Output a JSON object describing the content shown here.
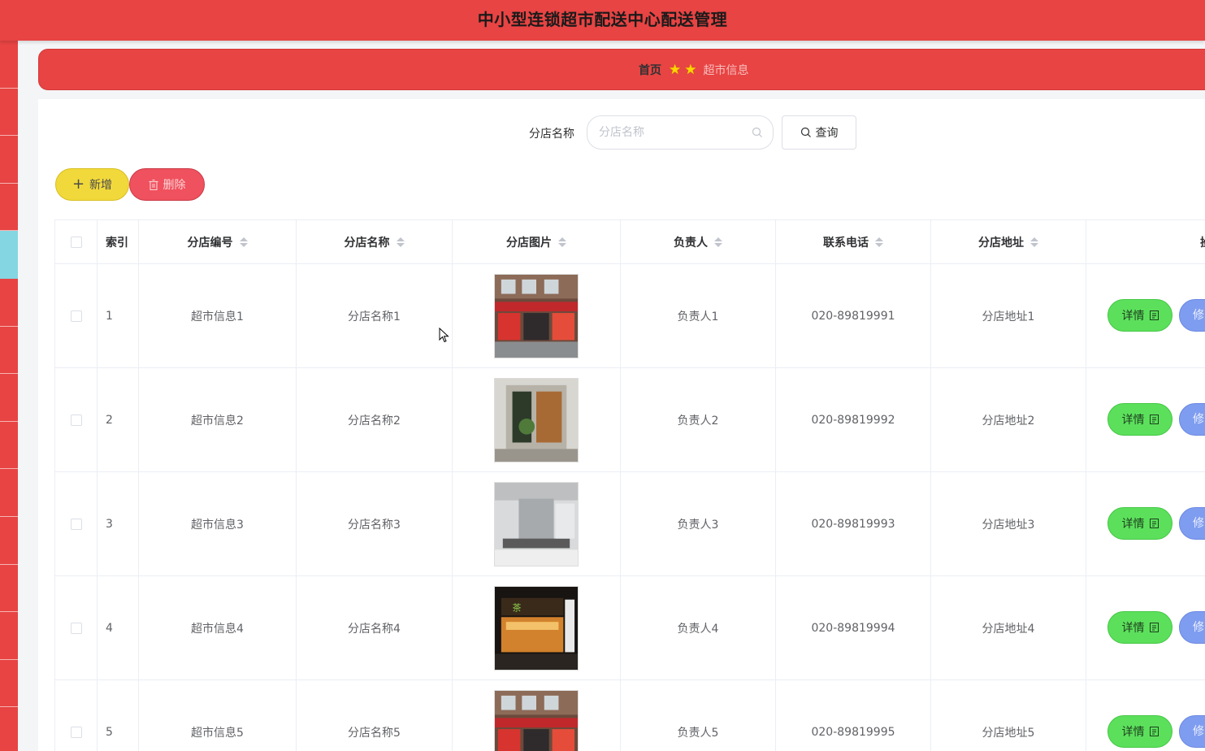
{
  "app": {
    "title": "中小型连锁超市配送中心配送管理"
  },
  "breadcrumb": {
    "home": "首页",
    "current": "超市信息"
  },
  "search": {
    "label": "分店名称",
    "placeholder": "分店名称",
    "value": "",
    "query_label": "查询"
  },
  "toolbar": {
    "add_label": "新增",
    "delete_label": "删除"
  },
  "table": {
    "columns": [
      "索引",
      "分店编号",
      "分店名称",
      "分店图片",
      "负责人",
      "联系电话",
      "分店地址",
      "操作"
    ],
    "detail_label": "详情",
    "edit_label": "修",
    "rows": [
      {
        "index": "1",
        "code": "超市信息1",
        "name": "分店名称1",
        "manager": "负责人1",
        "phone": "020-89819991",
        "address": "分店地址1",
        "image": "storefront-photo-1"
      },
      {
        "index": "2",
        "code": "超市信息2",
        "name": "分店名称2",
        "manager": "负责人2",
        "phone": "020-89819992",
        "address": "分店地址2",
        "image": "storefront-photo-2"
      },
      {
        "index": "3",
        "code": "超市信息3",
        "name": "分店名称3",
        "manager": "负责人3",
        "phone": "020-89819993",
        "address": "分店地址3",
        "image": "storefront-photo-3"
      },
      {
        "index": "4",
        "code": "超市信息4",
        "name": "分店名称4",
        "manager": "负责人4",
        "phone": "020-89819994",
        "address": "分店地址4",
        "image": "storefront-photo-4"
      },
      {
        "index": "5",
        "code": "超市信息5",
        "name": "分店名称5",
        "manager": "负责人5",
        "phone": "020-89819995",
        "address": "分店地址5",
        "image": "storefront-photo-5"
      }
    ]
  },
  "colors": {
    "header": "#e74443",
    "sidebar_active": "#83d6e2",
    "add": "#f2d93b",
    "delete": "#f0515e",
    "detail": "#5ce05c",
    "edit": "#7f9df0"
  }
}
